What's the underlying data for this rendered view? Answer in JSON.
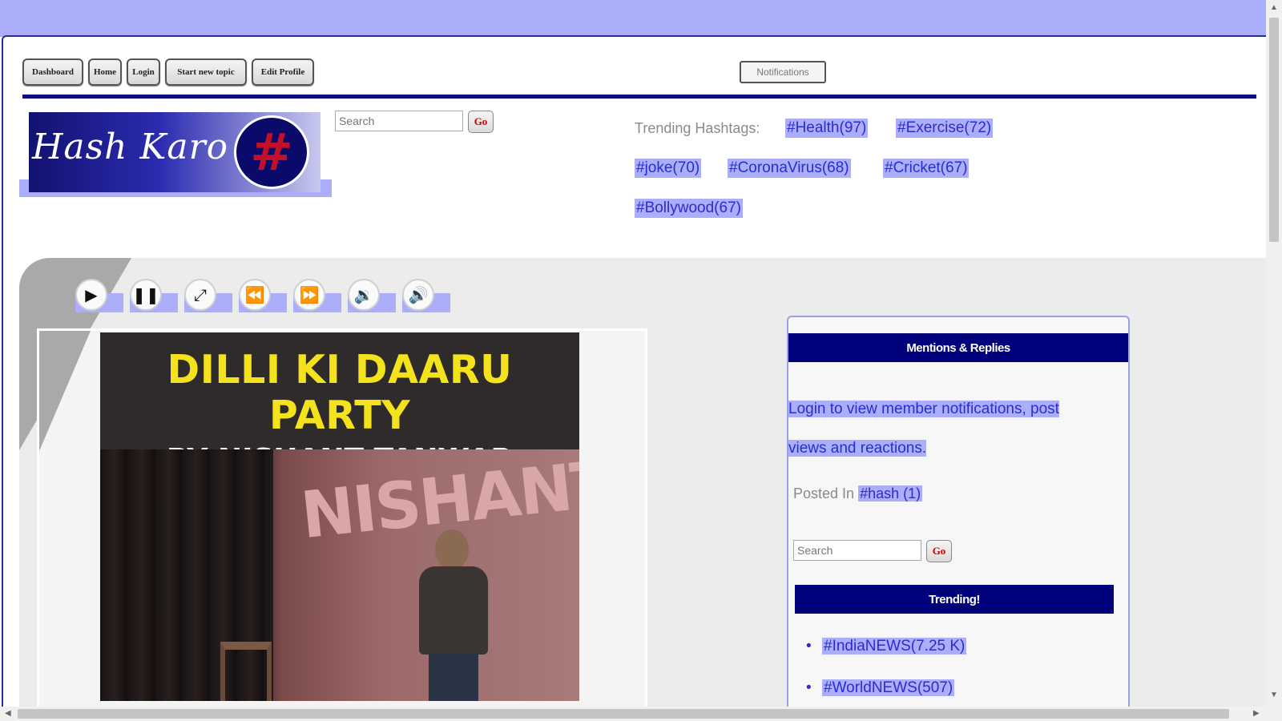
{
  "nav": {
    "buttons": [
      "Dashboard",
      "Home",
      "Login",
      "Start new topic",
      "Edit Profile"
    ],
    "notifications": "Notifications"
  },
  "logo": {
    "text": "Hash Karo",
    "symbol": "#"
  },
  "search": {
    "placeholder": "Search",
    "go": "Go"
  },
  "trending_header": {
    "label": "Trending Hashtags:",
    "tags": [
      "#Health(97)",
      "#Exercise(72)",
      "#joke(70)",
      "#CoronaVirus(68)",
      "#Cricket(67)",
      "#Bollywood(67)"
    ]
  },
  "player": {
    "controls": [
      "play-icon",
      "pause-icon",
      "fullscreen-icon",
      "rewind-icon",
      "fast-forward-icon",
      "volume-down-icon",
      "volume-up-icon"
    ],
    "thumbnail": {
      "title": "DILLI KI DAARU PARTY",
      "subtitle": "BY NISHANT TANWAR",
      "backdrop_text": "NISHANT"
    }
  },
  "panel": {
    "mentions_header": "Mentions & Replies",
    "login_msg_line1": "Login to view member notifications, post",
    "login_msg_line2": "views and reactions.",
    "posted_in_label": "Posted In",
    "posted_in_tag": "#hash (1)",
    "trending_header": "Trending!",
    "trending": [
      "#IndiaNEWS(7.25 K)",
      "#WorldNEWS(507)"
    ]
  },
  "colors": {
    "accent": "#abaefb",
    "navy": "#00007a",
    "link": "#2c2ccc",
    "thumb_title": "#f3e21c"
  }
}
